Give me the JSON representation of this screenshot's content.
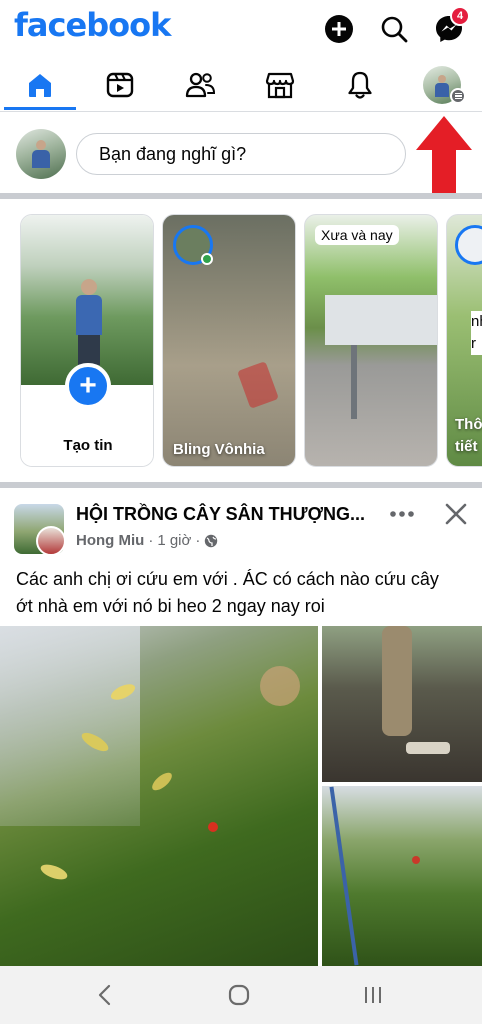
{
  "header": {
    "logo": "facebook",
    "messenger_badge": "4"
  },
  "tabs": [
    {
      "name": "home",
      "active": true
    },
    {
      "name": "video",
      "active": false
    },
    {
      "name": "friends",
      "active": false
    },
    {
      "name": "marketplace",
      "active": false
    },
    {
      "name": "notifications",
      "active": false
    },
    {
      "name": "profile-menu",
      "active": false
    }
  ],
  "composer": {
    "placeholder": "Bạn đang nghĩ gì?"
  },
  "stories": {
    "create_label": "Tạo tin",
    "items": [
      {
        "name": "Bling Vônhia",
        "pill": ""
      },
      {
        "name": "",
        "pill": "Xưa và nay"
      },
      {
        "name": "Thô tiết",
        "pill": "",
        "side_text": "nh r"
      }
    ]
  },
  "post": {
    "group_name": "HỘI TRỒNG CÂY SÂN THƯỢNG...",
    "author": "Hong Miu",
    "time": "1 giờ",
    "separator": "·",
    "text": "Các anh chị ơi cứu em với . ÁC có cách nào cứu cây ớt nhà em với nó bi heo 2 ngay nay roi"
  },
  "colors": {
    "brand": "#1877f2",
    "badge": "#e41e3f",
    "annotation_arrow": "#e41e26"
  }
}
